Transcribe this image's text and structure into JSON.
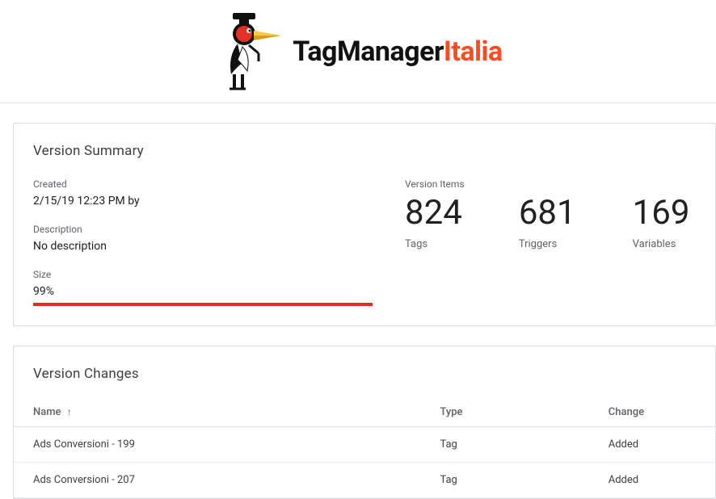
{
  "logo": {
    "text_black": "TagManager",
    "text_orange": "Italia"
  },
  "summary": {
    "title": "Version Summary",
    "created_label": "Created",
    "created_value": "2/15/19 12:23 PM by",
    "description_label": "Description",
    "description_value": "No description",
    "size_label": "Size",
    "size_value": "99%",
    "items_label": "Version Items",
    "stats": {
      "tags_num": "824",
      "tags_label": "Tags",
      "triggers_num": "681",
      "triggers_label": "Triggers",
      "variables_num": "169",
      "variables_label": "Variables"
    }
  },
  "changes": {
    "title": "Version Changes",
    "headers": {
      "name": "Name",
      "type": "Type",
      "change": "Change"
    },
    "rows": [
      {
        "name": "Ads Conversioni - 199",
        "type": "Tag",
        "change": "Added"
      },
      {
        "name": "Ads Conversioni - 207",
        "type": "Tag",
        "change": "Added"
      }
    ]
  }
}
